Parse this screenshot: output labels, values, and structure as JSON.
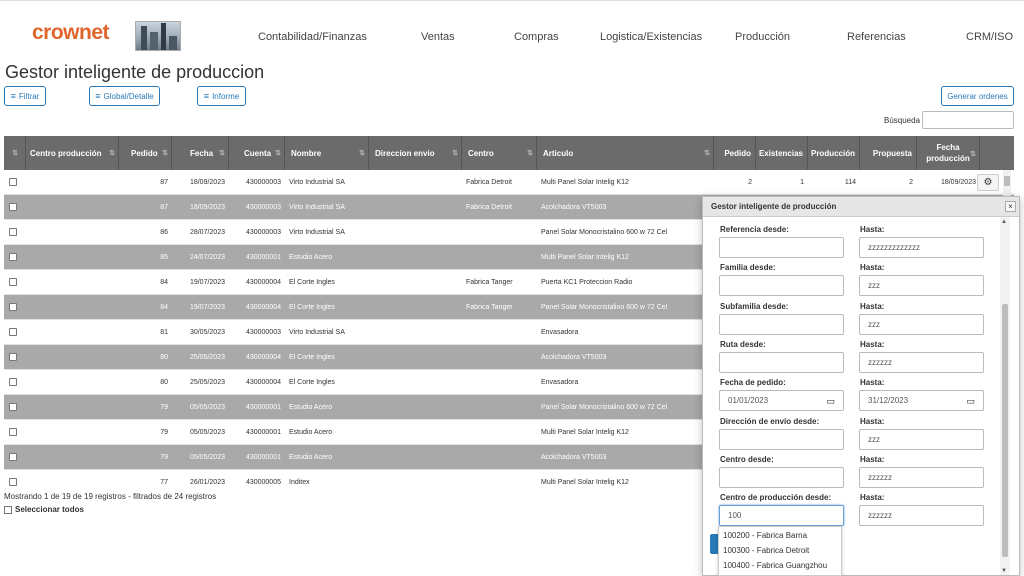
{
  "brand": {
    "logo": "crownet",
    "logo_image": "city-skyline-image"
  },
  "nav": {
    "items": [
      "Contabilidad/Finanzas",
      "Ventas",
      "Compras",
      "Logistica/Existencias",
      "Producción",
      "Referencias",
      "CRM/ISO"
    ]
  },
  "page": {
    "title": "Gestor inteligente de produccion"
  },
  "toolbar": {
    "filter_label": "Filtrar",
    "global_label": "Global/Detalle",
    "report_label": "Informe",
    "generate_label": "Generar ordenes",
    "search_label": "Búsqueda",
    "search_value": ""
  },
  "table": {
    "headers": [
      "",
      "Centro producción",
      "Pedido",
      "Fecha",
      "Cuenta",
      "Nombre",
      "Direccion envio",
      "Centro",
      "Articulo",
      "Pedido",
      "Existencias",
      "Producción",
      "Propuesta",
      "Fecha producción",
      ""
    ],
    "rows": [
      {
        "pedido": "87",
        "fecha": "18/09/2023",
        "cuenta": "430000003",
        "nombre": "Virto Industrial SA",
        "centro": "Fabrica Detroit",
        "articulo": "Multi Panel Solar Intelig K12",
        "ped": "2",
        "exist": "1",
        "prod": "114",
        "prop": "2",
        "fprod": "18/09/2023"
      },
      {
        "pedido": "87",
        "fecha": "18/09/2023",
        "cuenta": "430000003",
        "nombre": "Virto Industrial SA",
        "centro": "Fabrica Detroit",
        "articulo": "Acolchadora VT5003"
      },
      {
        "pedido": "86",
        "fecha": "28/07/2023",
        "cuenta": "430000003",
        "nombre": "Virto Industrial SA",
        "centro": "",
        "articulo": "Panel Solar Monocristalino 600 w 72 Cel"
      },
      {
        "pedido": "85",
        "fecha": "24/07/2023",
        "cuenta": "430000001",
        "nombre": "Estudio Acero",
        "centro": "",
        "articulo": "Multi Panel Solar Intelig K12"
      },
      {
        "pedido": "84",
        "fecha": "19/07/2023",
        "cuenta": "430000004",
        "nombre": "El Corte Ingles",
        "centro": "Fabrica Tanger",
        "articulo": "Puerta KC1 Proteccion Radio"
      },
      {
        "pedido": "84",
        "fecha": "19/07/2023",
        "cuenta": "430000004",
        "nombre": "El Corte Ingles",
        "centro": "Fabrica Tanger",
        "articulo": "Panel Solar Monocristalino 600 w 72 Cel"
      },
      {
        "pedido": "81",
        "fecha": "30/05/2023",
        "cuenta": "430000003",
        "nombre": "Virto Industrial SA",
        "centro": "",
        "articulo": "Envasadora"
      },
      {
        "pedido": "80",
        "fecha": "25/05/2023",
        "cuenta": "430000004",
        "nombre": "El Corte Ingles",
        "centro": "",
        "articulo": "Acolchadora VT5003"
      },
      {
        "pedido": "80",
        "fecha": "25/05/2023",
        "cuenta": "430000004",
        "nombre": "El Corte Ingles",
        "centro": "",
        "articulo": "Envasadora"
      },
      {
        "pedido": "79",
        "fecha": "05/05/2023",
        "cuenta": "430000001",
        "nombre": "Estudio Acero",
        "centro": "",
        "articulo": "Panel Solar Monocristalino 600 w 72 Cel"
      },
      {
        "pedido": "79",
        "fecha": "05/05/2023",
        "cuenta": "430000001",
        "nombre": "Estudio Acero",
        "centro": "",
        "articulo": "Multi Panel Solar Intelig K12"
      },
      {
        "pedido": "79",
        "fecha": "05/05/2023",
        "cuenta": "430000001",
        "nombre": "Estudio Acero",
        "centro": "",
        "articulo": "Acolchadora VT5003"
      },
      {
        "pedido": "77",
        "fecha": "26/01/2023",
        "cuenta": "430000005",
        "nombre": "Inditex",
        "centro": "",
        "articulo": "Multi Panel Solar Intelig K12"
      }
    ]
  },
  "footer": {
    "info": "Mostrando 1 de 19 de 19 registros - filtrados de 24 registros",
    "select_all": "Seleccionar todos"
  },
  "modal": {
    "title": "Gestor inteligente de producción",
    "fields": [
      {
        "label": "Referencia desde:",
        "value": "",
        "to_label": "Hasta:",
        "to_value": "zzzzzzzzzzzzz"
      },
      {
        "label": "Familia desde:",
        "value": "",
        "to_label": "Hasta:",
        "to_value": "zzz"
      },
      {
        "label": "Subfamilia desde:",
        "value": "",
        "to_label": "Hasta:",
        "to_value": "zzz"
      },
      {
        "label": "Ruta desde:",
        "value": "",
        "to_label": "Hasta:",
        "to_value": "zzzzzz"
      },
      {
        "label": "Fecha de pedido:",
        "value": "01/01/2023",
        "to_label": "Hasta:",
        "to_value": "31/12/2023"
      },
      {
        "label": "Dirección de envío desde:",
        "value": "",
        "to_label": "Hasta:",
        "to_value": "zzz"
      },
      {
        "label": "Centro desde:",
        "value": "",
        "to_label": "Hasta:",
        "to_value": "zzzzzz"
      },
      {
        "label": "Centro de producción desde:",
        "value": "100",
        "to_label": "Hasta:",
        "to_value": "zzzzzz"
      }
    ],
    "autocomplete": [
      "100200 - Fabrica Barna",
      "100300 - Fabrica Detroit",
      "100400 - Fabrica Guangzhou"
    ]
  },
  "colors": {
    "accent": "#2a7ab8",
    "brand": "#e0662c",
    "header_bg": "#6b6b6b",
    "alt_row": "#a9a9a9"
  }
}
